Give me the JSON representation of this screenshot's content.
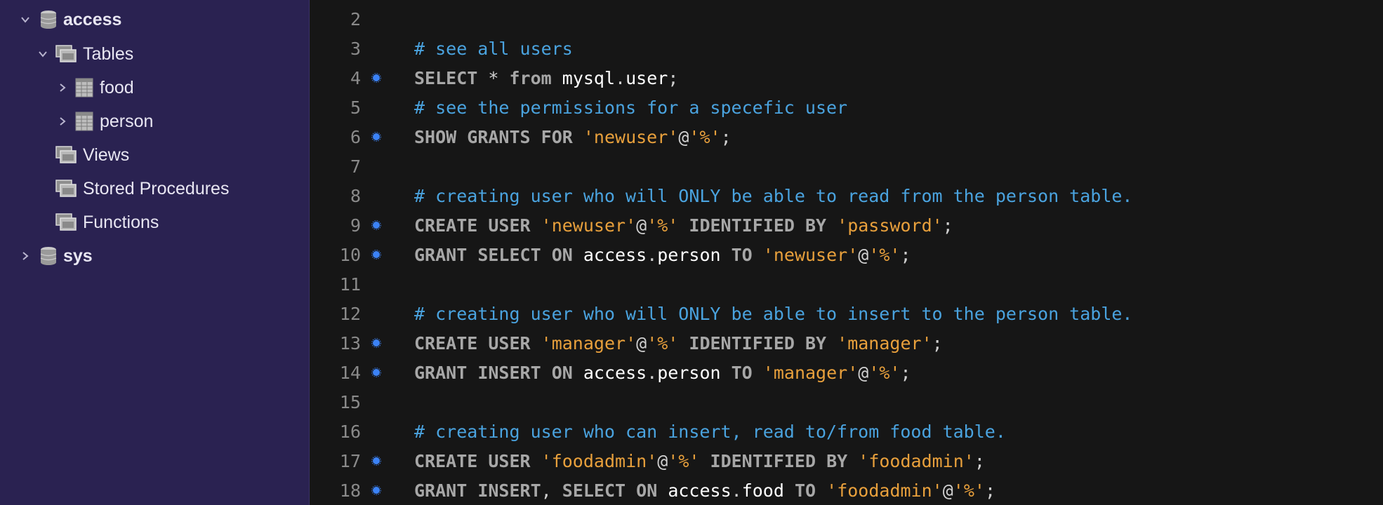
{
  "sidebar": {
    "items": [
      {
        "label": "access",
        "icon": "database-icon",
        "expanded": true
      },
      {
        "label": "Tables",
        "icon": "folder-stack-icon",
        "expanded": true
      },
      {
        "label": "food",
        "icon": "table-icon",
        "expanded": false
      },
      {
        "label": "person",
        "icon": "table-icon",
        "expanded": false
      },
      {
        "label": "Views",
        "icon": "folder-stack-icon"
      },
      {
        "label": "Stored Procedures",
        "icon": "folder-stack-icon"
      },
      {
        "label": "Functions",
        "icon": "folder-stack-icon"
      },
      {
        "label": "sys",
        "icon": "database-icon",
        "expanded": false
      }
    ]
  },
  "editor": {
    "lines": [
      {
        "num": "2",
        "text": ""
      },
      {
        "num": "3",
        "text": "# see all users"
      },
      {
        "num": "4",
        "text": "SELECT * from mysql.user;"
      },
      {
        "num": "5",
        "text": "# see the permissions for a specefic user"
      },
      {
        "num": "6",
        "text": "SHOW GRANTS FOR 'newuser'@'%';"
      },
      {
        "num": "7",
        "text": ""
      },
      {
        "num": "8",
        "text": "# creating user who will ONLY be able to read from the person table."
      },
      {
        "num": "9",
        "text": "CREATE USER 'newuser'@'%' IDENTIFIED BY 'password';"
      },
      {
        "num": "10",
        "text": "GRANT SELECT ON access.person TO 'newuser'@'%';"
      },
      {
        "num": "11",
        "text": ""
      },
      {
        "num": "12",
        "text": "# creating user who will ONLY be able to insert to the person table."
      },
      {
        "num": "13",
        "text": "CREATE USER 'manager'@'%' IDENTIFIED BY 'manager';"
      },
      {
        "num": "14",
        "text": "GRANT INSERT ON access.person TO 'manager'@'%';"
      },
      {
        "num": "15",
        "text": ""
      },
      {
        "num": "16",
        "text": "# creating user who can insert, read to/from food table."
      },
      {
        "num": "17",
        "text": "CREATE USER 'foodadmin'@'%' IDENTIFIED BY 'foodadmin';"
      },
      {
        "num": "18",
        "text": "GRANT INSERT, SELECT ON access.food TO 'foodadmin'@'%';"
      }
    ],
    "breakpoint_lines": [
      "4",
      "6",
      "9",
      "10",
      "13",
      "14",
      "17",
      "18"
    ]
  },
  "colors": {
    "sidebar_bg": "#2a2251",
    "editor_bg": "#161616",
    "comment": "#4aa3df",
    "keyword": "#a7a7a7",
    "string": "#e8a03c",
    "breakpoint": "#3b82f6"
  }
}
